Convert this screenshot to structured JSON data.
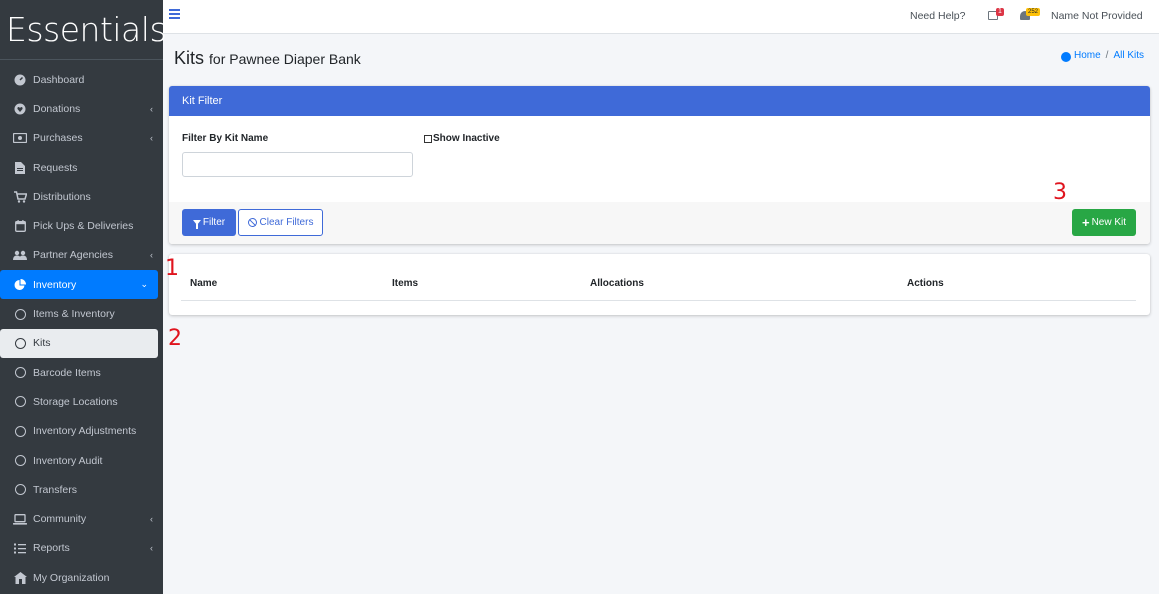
{
  "sidebar": {
    "brand": "Essentials",
    "items": [
      {
        "label": "Dashboard",
        "icon": "dashboard-icon"
      },
      {
        "label": "Donations",
        "icon": "heart-icon",
        "chevron": "‹"
      },
      {
        "label": "Purchases",
        "icon": "money-icon",
        "chevron": "‹"
      },
      {
        "label": "Requests",
        "icon": "file-icon"
      },
      {
        "label": "Distributions",
        "icon": "cart-icon"
      },
      {
        "label": "Pick Ups & Deliveries",
        "icon": "calendar-icon"
      },
      {
        "label": "Partner Agencies",
        "icon": "users-icon",
        "chevron": "‹"
      },
      {
        "label": "Inventory",
        "icon": "pie-chart-icon",
        "chevron": "⌄"
      },
      {
        "label": "Items & Inventory",
        "icon": "circle-icon"
      },
      {
        "label": "Kits",
        "icon": "circle-icon"
      },
      {
        "label": "Barcode Items",
        "icon": "circle-icon"
      },
      {
        "label": "Storage Locations",
        "icon": "circle-icon"
      },
      {
        "label": "Inventory Adjustments",
        "icon": "circle-icon"
      },
      {
        "label": "Inventory Audit",
        "icon": "circle-icon"
      },
      {
        "label": "Transfers",
        "icon": "circle-icon"
      },
      {
        "label": "Community",
        "icon": "laptop-icon",
        "chevron": "‹"
      },
      {
        "label": "Reports",
        "icon": "list-icon",
        "chevron": "‹"
      },
      {
        "label": "My Organization",
        "icon": "building-icon"
      }
    ]
  },
  "topbar": {
    "help": "Need Help?",
    "gift_badge": "1",
    "bell_badge": "252",
    "user": "Name Not Provided"
  },
  "header": {
    "title": "Kits",
    "subtitle": "for Pawnee Diaper Bank",
    "breadcrumb_home": "Home",
    "breadcrumb_sep": "/",
    "breadcrumb_current": "All Kits"
  },
  "filter": {
    "card_title": "Kit Filter",
    "name_label": "Filter By Kit Name",
    "name_value": "",
    "inactive_label": "Show Inactive",
    "filter_button": "Filter",
    "clear_button": "Clear Filters",
    "new_button": "New Kit"
  },
  "table": {
    "columns": [
      "Name",
      "Items",
      "Allocations",
      "Actions"
    ]
  },
  "annotations": [
    "1",
    "2",
    "3"
  ],
  "colors": {
    "sidebar_bg": "#343a40",
    "primary": "#3f6ad8",
    "active_nav": "#007bff",
    "success": "#28a745",
    "annotation": "#e0141e"
  }
}
